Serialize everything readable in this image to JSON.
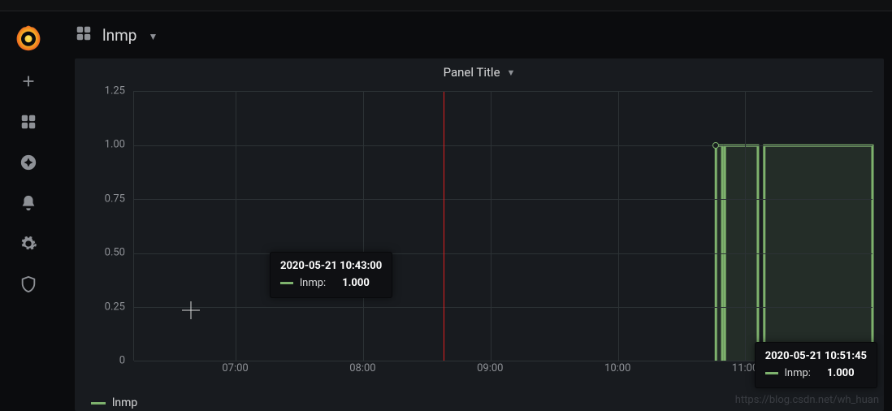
{
  "header": {
    "dashboard_name": "lnmp"
  },
  "panel": {
    "title": "Panel Title"
  },
  "chart_data": {
    "type": "line",
    "series_name": "lnmp",
    "series_color": "#7eb26d",
    "ylim": [
      0,
      1.25
    ],
    "y_ticks": [
      0,
      0.25,
      0.5,
      0.75,
      1.0,
      1.25
    ],
    "y_tick_labels": [
      "0",
      "0.25",
      "0.50",
      "0.75",
      "1.00",
      "1.25"
    ],
    "x_tick_labels": [
      "07:00",
      "08:00",
      "09:00",
      "10:00",
      "11:00"
    ],
    "x_range_hours": [
      6.2,
      12.0
    ],
    "marker_time_hours": 8.63,
    "hover_point_time_hours": 10.77,
    "segments": [
      {
        "start_h": 10.77,
        "end_h": 10.82,
        "value": 1.0
      },
      {
        "start_h": 10.84,
        "end_h": 11.1,
        "value": 1.0
      },
      {
        "start_h": 11.15,
        "end_h": 12.0,
        "value": 1.0
      }
    ]
  },
  "tooltip_a": {
    "time": "2020-05-21 10:43:00",
    "series": "lnmp:",
    "value": "1.000"
  },
  "tooltip_b": {
    "time": "2020-05-21 10:51:45",
    "series": "lnmp:",
    "value": "1.000"
  },
  "legend": {
    "label": "lnmp"
  },
  "watermark": "https://blog.csdn.net/wh_huan"
}
